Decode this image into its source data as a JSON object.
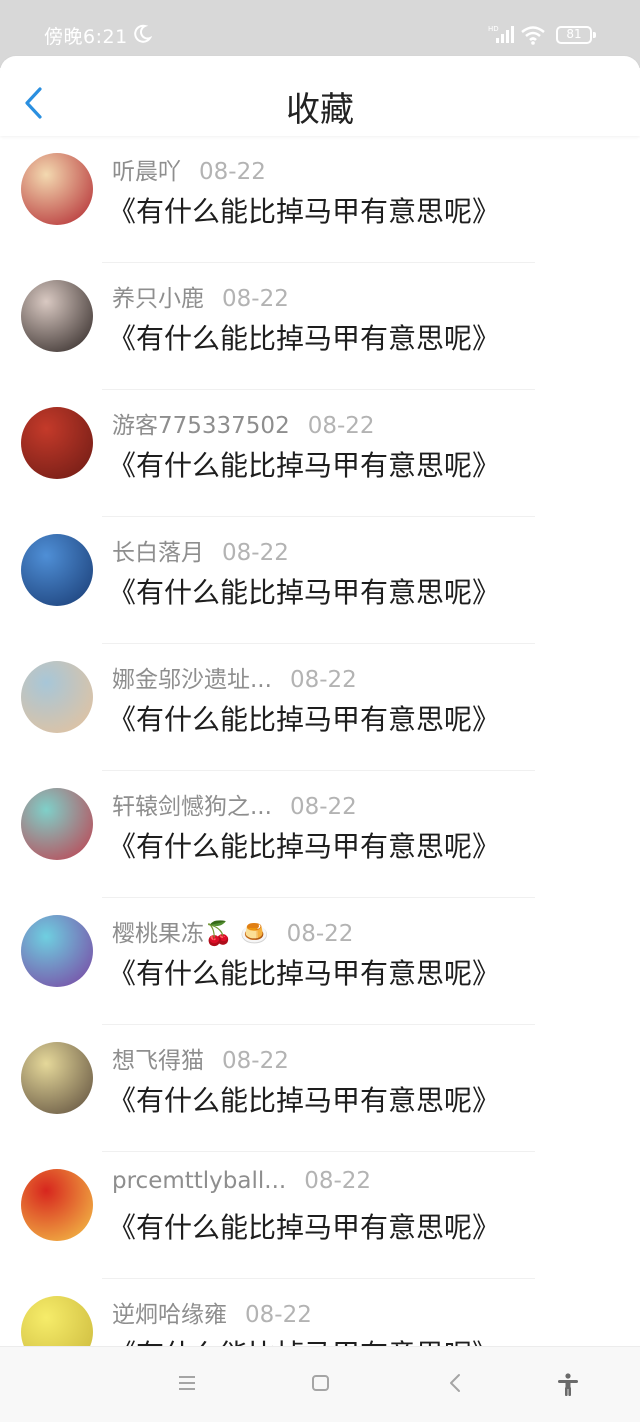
{
  "status_bar": {
    "time": "傍晚6:21",
    "battery": "81"
  },
  "header": {
    "title": "收藏"
  },
  "items": [
    {
      "name": "听晨吖",
      "date": "08-22",
      "book": "《有什么能比掉马甲有意思呢》",
      "avatar_colors": [
        "#f3d9b0",
        "#b0232c"
      ]
    },
    {
      "name": "养只小鹿",
      "date": "08-22",
      "book": "《有什么能比掉马甲有意思呢》",
      "avatar_colors": [
        "#d9c9c2",
        "#2a2220"
      ]
    },
    {
      "name": "游客775337502",
      "date": "08-22",
      "book": "《有什么能比掉马甲有意思呢》",
      "avatar_colors": [
        "#c43a2a",
        "#6b1a14"
      ]
    },
    {
      "name": "长白落月",
      "date": "08-22",
      "book": "《有什么能比掉马甲有意思呢》",
      "avatar_colors": [
        "#4f8fd6",
        "#183a72"
      ]
    },
    {
      "name": "娜金邬沙遗址...",
      "date": "08-22",
      "book": "《有什么能比掉马甲有意思呢》",
      "avatar_colors": [
        "#a7c6d8",
        "#e8c29a"
      ]
    },
    {
      "name": "轩辕剑憾狗之...",
      "date": "08-22",
      "book": "《有什么能比掉马甲有意思呢》",
      "avatar_colors": [
        "#7fd0c9",
        "#c23a4a"
      ]
    },
    {
      "name": "樱桃果冻🍒 🍮",
      "date": "08-22",
      "book": "《有什么能比掉马甲有意思呢》",
      "avatar_colors": [
        "#6fcfe0",
        "#7a3fa0"
      ]
    },
    {
      "name": "想飞得猫",
      "date": "08-22",
      "book": "《有什么能比掉马甲有意思呢》",
      "avatar_colors": [
        "#e5d89a",
        "#5a4a3a"
      ]
    },
    {
      "name": "prcemttlyball...",
      "date": "08-22",
      "book": "《有什么能比掉马甲有意思呢》",
      "avatar_colors": [
        "#d7261e",
        "#f5c84a"
      ]
    },
    {
      "name": "逆炯哈缘雍",
      "date": "08-22",
      "book": "《有什么能比掉马甲有意思呢》",
      "avatar_colors": [
        "#f6ec6a",
        "#c9b63a"
      ]
    }
  ],
  "nav_keys": [
    "menu-key",
    "home-key",
    "back-key",
    "accessibility-key"
  ]
}
